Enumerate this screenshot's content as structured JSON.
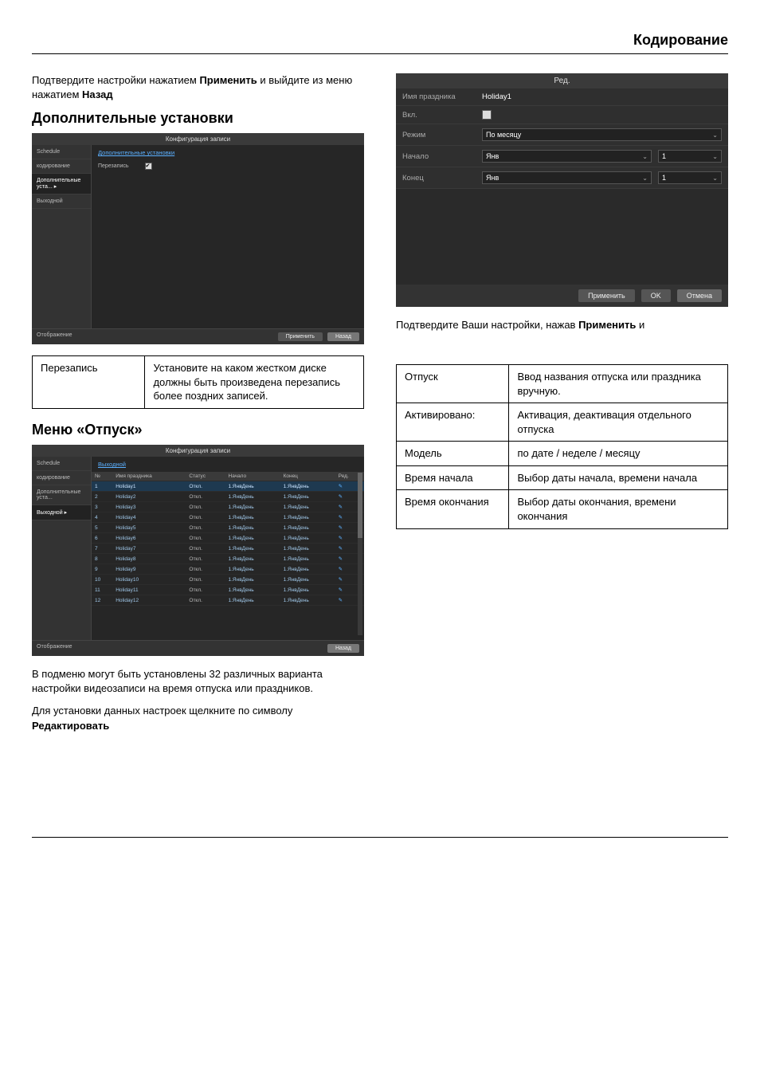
{
  "header": "Кодирование",
  "intro_para": {
    "pre": "Подтвердите настройки нажатием ",
    "apply": "Применить",
    "mid": " и выйдите из меню нажатием ",
    "back": "Назад"
  },
  "sec1_heading": "Дополнительные установки",
  "app1": {
    "title": "Конфигурация записи",
    "sidebar": [
      "Schedule",
      "кодирование",
      "Дополнительные уста...",
      "Выходной"
    ],
    "active_index": 2,
    "tab": "Дополнительные установки",
    "row_label": "Перезапись",
    "footer_left": "Отображение",
    "btn_apply": "Применить",
    "btn_back": "Назад"
  },
  "table1": {
    "left": "Перезапись",
    "right": "Установите на каком жестком диске должны быть произведена перезапись более поздних записей."
  },
  "sec2_heading": "Меню «Отпуск»",
  "app2": {
    "title": "Конфигурация записи",
    "sidebar": [
      "Schedule",
      "кодирование",
      "Дополнительные уста...",
      "Выходной"
    ],
    "active_index": 3,
    "tab": "Выходной",
    "columns": [
      "№",
      "Имя праздника",
      "Статус",
      "Начало",
      "Конец",
      "Ред."
    ],
    "rows": [
      {
        "n": "1",
        "name": "Holiday1",
        "status": "Откл.",
        "start": "1.ЯнвДень",
        "end": "1.ЯнвДень"
      },
      {
        "n": "2",
        "name": "Holiday2",
        "status": "Откл.",
        "start": "1.ЯнвДень",
        "end": "1.ЯнвДень"
      },
      {
        "n": "3",
        "name": "Holiday3",
        "status": "Откл.",
        "start": "1.ЯнвДень",
        "end": "1.ЯнвДень"
      },
      {
        "n": "4",
        "name": "Holiday4",
        "status": "Откл.",
        "start": "1.ЯнвДень",
        "end": "1.ЯнвДень"
      },
      {
        "n": "5",
        "name": "Holiday5",
        "status": "Откл.",
        "start": "1.ЯнвДень",
        "end": "1.ЯнвДень"
      },
      {
        "n": "6",
        "name": "Holiday6",
        "status": "Откл.",
        "start": "1.ЯнвДень",
        "end": "1.ЯнвДень"
      },
      {
        "n": "7",
        "name": "Holiday7",
        "status": "Откл.",
        "start": "1.ЯнвДень",
        "end": "1.ЯнвДень"
      },
      {
        "n": "8",
        "name": "Holiday8",
        "status": "Откл.",
        "start": "1.ЯнвДень",
        "end": "1.ЯнвДень"
      },
      {
        "n": "9",
        "name": "Holiday9",
        "status": "Откл.",
        "start": "1.ЯнвДень",
        "end": "1.ЯнвДень"
      },
      {
        "n": "10",
        "name": "Holiday10",
        "status": "Откл.",
        "start": "1.ЯнвДень",
        "end": "1.ЯнвДень"
      },
      {
        "n": "11",
        "name": "Holiday11",
        "status": "Откл.",
        "start": "1.ЯнвДень",
        "end": "1.ЯнвДень"
      },
      {
        "n": "12",
        "name": "Holiday12",
        "status": "Откл.",
        "start": "1.ЯнвДень",
        "end": "1.ЯнвДень"
      }
    ],
    "footer_left": "Отображение",
    "btn_back": "Назад"
  },
  "para_submenu": "В подменю могут быть установлены 32 различных варианта настройки видеозаписи на время отпуска или праздников.",
  "para_edit": {
    "pre": "Для установки данных настроек щелкните по символу ",
    "bold": "Редактировать"
  },
  "dlg": {
    "title": "Ред.",
    "rows": {
      "name_label": "Имя праздника",
      "name_value": "Holiday1",
      "enable_label": "Вкл.",
      "mode_label": "Режим",
      "mode_value": "По месяцу",
      "start_label": "Начало",
      "start_month": "Янв",
      "start_day": "1",
      "end_label": "Конец",
      "end_month": "Янв",
      "end_day": "1"
    },
    "btn_apply": "Применить",
    "btn_ok": "OK",
    "btn_cancel": "Отмена"
  },
  "para_confirm": {
    "pre": "Подтвердите Ваши настройки, нажав ",
    "bold": "Применить",
    "post": " и"
  },
  "table2": [
    {
      "l": "Отпуск",
      "r": "Ввод названия отпуска или праздника вручную."
    },
    {
      "l": "Активировано:",
      "r": "Активация, деактивация отдельного отпуска"
    },
    {
      "l": "Модель",
      "r": "по дате / неделе / месяцу"
    },
    {
      "l": "Время начала",
      "r": "Выбор даты начала, времени начала"
    },
    {
      "l": "Время окончания",
      "r": "Выбор даты окончания, времени окончания"
    }
  ]
}
